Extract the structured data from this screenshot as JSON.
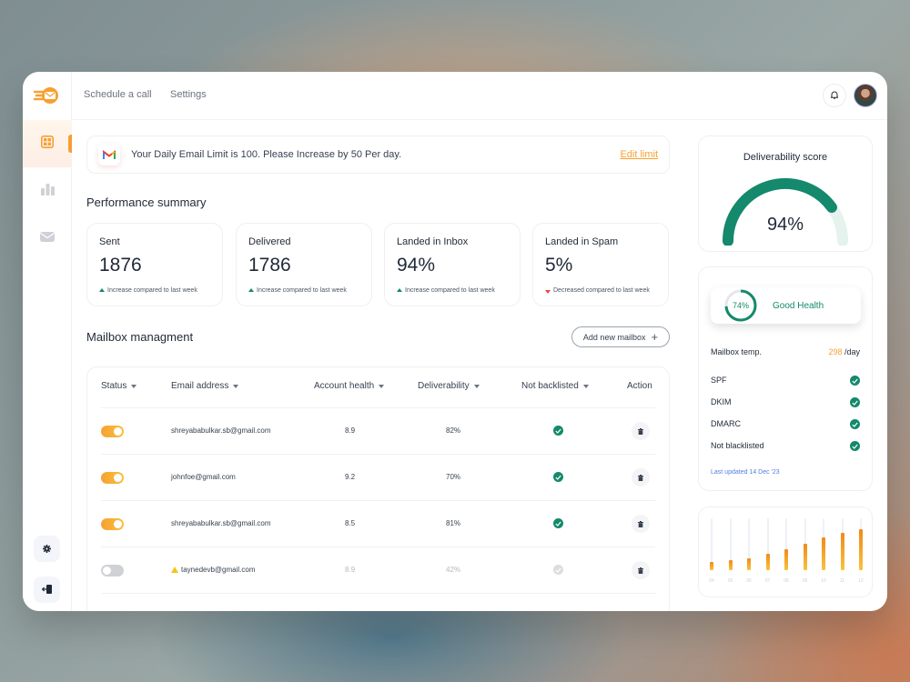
{
  "topnav": {
    "links": [
      "Schedule a call",
      "Settings"
    ]
  },
  "banner": {
    "text": "Your Daily Email Limit is 100. Please Increase by 50 Per day.",
    "action": "Edit limit"
  },
  "performance": {
    "title": "Performance summary",
    "cards": [
      {
        "label": "Sent",
        "value": "1876",
        "note": "Increase compared to last week",
        "trend": "up"
      },
      {
        "label": "Delivered",
        "value": "1786",
        "note": "Increase compared to last week",
        "trend": "up"
      },
      {
        "label": "Landed in Inbox",
        "value": "94%",
        "note": "Increase compared to last week",
        "trend": "up"
      },
      {
        "label": "Landed in Spam",
        "value": "5%",
        "note": "Decreased compared to last week",
        "trend": "down"
      }
    ]
  },
  "mailbox": {
    "title": "Mailbox managment",
    "add_button": "Add new mailbox",
    "columns": [
      "Status",
      "Email address",
      "Account health",
      "Deliverability",
      "Not backlisted",
      "Action"
    ],
    "rows": [
      {
        "enabled": true,
        "email": "shreyababulkar.sb@gmail.com",
        "health": "8.9",
        "deliverability": "82%",
        "not_blacklisted": true,
        "warning": false
      },
      {
        "enabled": true,
        "email": "johnfoe@gmail.com",
        "health": "9.2",
        "deliverability": "70%",
        "not_blacklisted": true,
        "warning": false
      },
      {
        "enabled": true,
        "email": "shreyababulkar.sb@gmail.com",
        "health": "8.5",
        "deliverability": "81%",
        "not_blacklisted": true,
        "warning": false
      },
      {
        "enabled": false,
        "email": "taynedevb@gmail.com",
        "health": "8.9",
        "deliverability": "42%",
        "not_blacklisted": false,
        "warning": true
      }
    ]
  },
  "deliverability": {
    "title": "Deliverability score",
    "value_label": "94%",
    "value": 94
  },
  "health": {
    "percent_label": "74%",
    "percent": 74,
    "status": "Good Health",
    "mailbox_temp_label": "Mailbox temp.",
    "mailbox_temp_value": "298",
    "mailbox_temp_unit": "/day",
    "checks": [
      {
        "label": "SPF",
        "ok": true
      },
      {
        "label": "DKIM",
        "ok": true
      },
      {
        "label": "DMARC",
        "ok": true
      },
      {
        "label": "Not blacklisted",
        "ok": true
      }
    ],
    "last_updated": "Last updated 14 Dec '23"
  },
  "chart_data": {
    "type": "bar",
    "title": "",
    "xlabel": "",
    "ylabel": "",
    "categories": [
      "04",
      "05",
      "06",
      "07",
      "08",
      "09",
      "10",
      "11",
      "12"
    ],
    "values": [
      16,
      19,
      22,
      31,
      39,
      50,
      61,
      69,
      77
    ],
    "ylim": [
      0,
      100
    ],
    "grid": false
  },
  "colors": {
    "accent": "#f6a032",
    "success": "#14896b",
    "danger": "#e74848",
    "link": "#4f7fdc"
  }
}
